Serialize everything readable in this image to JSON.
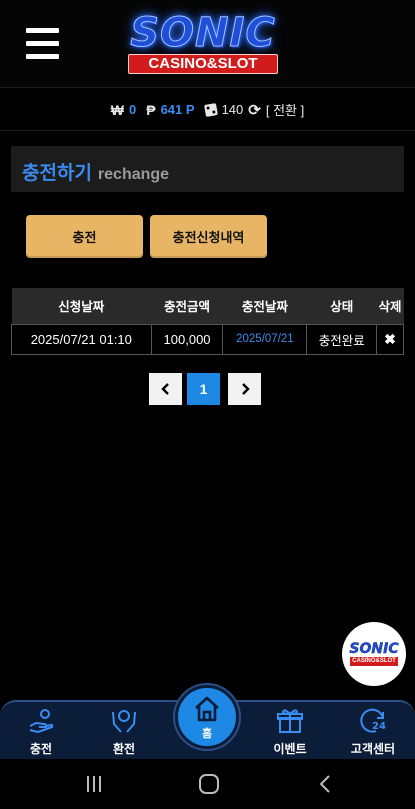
{
  "header": {
    "logo_main": "SONIC",
    "logo_sub": "CASINO&SLOT"
  },
  "status": {
    "won_symbol": "₩",
    "won_value": "0",
    "point_symbol": "₱",
    "point_value": "641 P",
    "dice_value": "140",
    "convert_label": "[ 전환 ]"
  },
  "section": {
    "title_ko": "충전하기",
    "title_en": "rechange"
  },
  "buttons": {
    "charge": "충전",
    "history": "충전신청내역"
  },
  "table": {
    "headers": [
      "신청날짜",
      "충전금액",
      "충전날짜",
      "상태",
      "삭제"
    ],
    "rows": [
      {
        "request_date": "2025/07/21 01:10",
        "amount": "100,000",
        "charge_date": "2025/07/21",
        "status": "충전완료",
        "delete": "✖"
      }
    ]
  },
  "pagination": {
    "prev": "‹",
    "current": "1",
    "next": "›"
  },
  "floating": {
    "main": "SONIC",
    "sub": "CASINO&SLOT"
  },
  "bottom_nav": {
    "charge": "충전",
    "exchange": "환전",
    "home": "홈",
    "event": "이벤트",
    "support": "고객센터"
  },
  "colors": {
    "accent_blue": "#3b8cf0",
    "button_gold": "#e8b565",
    "nav_bg": "#0c1d3a",
    "home_blue": "#1e88e5"
  }
}
